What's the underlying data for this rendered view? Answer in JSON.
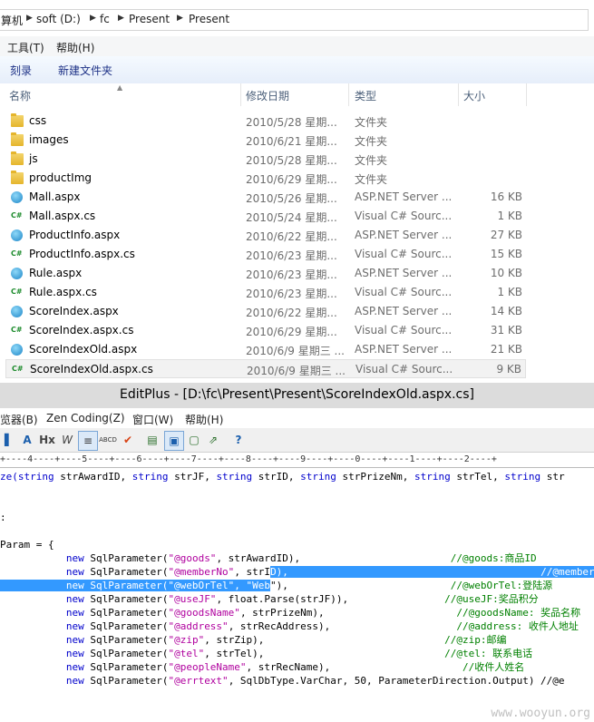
{
  "explorer": {
    "breadcrumb": [
      "算机",
      "soft (D:)",
      "fc",
      "Present",
      "Present"
    ],
    "menu": [
      "工具(T)",
      "帮助(H)"
    ],
    "commands": [
      "刻录",
      "新建文件夹"
    ],
    "columns": {
      "name": "名称",
      "date": "修改日期",
      "type": "类型",
      "size": "大小"
    },
    "files": [
      {
        "name": "css",
        "date": "2010/5/28 星期...",
        "type": "文件夹",
        "size": "",
        "icon": "folder"
      },
      {
        "name": "images",
        "date": "2010/6/21 星期...",
        "type": "文件夹",
        "size": "",
        "icon": "folder"
      },
      {
        "name": "js",
        "date": "2010/5/28 星期...",
        "type": "文件夹",
        "size": "",
        "icon": "folder"
      },
      {
        "name": "productImg",
        "date": "2010/6/29 星期...",
        "type": "文件夹",
        "size": "",
        "icon": "folder"
      },
      {
        "name": "Mall.aspx",
        "date": "2010/5/26 星期...",
        "type": "ASP.NET Server ...",
        "size": "16 KB",
        "icon": "aspx"
      },
      {
        "name": "Mall.aspx.cs",
        "date": "2010/5/24 星期...",
        "type": "Visual C# Sourc...",
        "size": "1 KB",
        "icon": "cs"
      },
      {
        "name": "ProductInfo.aspx",
        "date": "2010/6/22 星期...",
        "type": "ASP.NET Server ...",
        "size": "27 KB",
        "icon": "aspx"
      },
      {
        "name": "ProductInfo.aspx.cs",
        "date": "2010/6/23 星期...",
        "type": "Visual C# Sourc...",
        "size": "15 KB",
        "icon": "cs"
      },
      {
        "name": "Rule.aspx",
        "date": "2010/6/23 星期...",
        "type": "ASP.NET Server ...",
        "size": "10 KB",
        "icon": "aspx"
      },
      {
        "name": "Rule.aspx.cs",
        "date": "2010/6/23 星期...",
        "type": "Visual C# Sourc...",
        "size": "1 KB",
        "icon": "cs"
      },
      {
        "name": "ScoreIndex.aspx",
        "date": "2010/6/22 星期...",
        "type": "ASP.NET Server ...",
        "size": "14 KB",
        "icon": "aspx"
      },
      {
        "name": "ScoreIndex.aspx.cs",
        "date": "2010/6/29 星期...",
        "type": "Visual C# Sourc...",
        "size": "31 KB",
        "icon": "cs"
      },
      {
        "name": "ScoreIndexOld.aspx",
        "date": "2010/6/9 星期三 ...",
        "type": "ASP.NET Server ...",
        "size": "21 KB",
        "icon": "aspx"
      },
      {
        "name": "ScoreIndexOld.aspx.cs",
        "date": "2010/6/9 星期三 ...",
        "type": "Visual C# Sourc...",
        "size": "9 KB",
        "icon": "cs",
        "selected": true
      }
    ]
  },
  "editplus": {
    "title": "EditPlus - [D:\\fc\\Present\\Present\\ScoreIndexOld.aspx.cs]",
    "menu": [
      "览器(B)",
      "Zen Coding(Z)",
      "窗口(W)",
      "帮助(H)"
    ],
    "toolbar": [
      "A",
      "Hx",
      "W",
      "≡",
      "ABCD",
      "✔",
      "▤",
      "▣",
      "▢",
      "⇗",
      "?"
    ],
    "ruler": "+----4----+----5----+----6----+----7----+----8----+----9----+----0----+----1----+----2----+",
    "watermark": "www.wooyun.org"
  },
  "code_lines": [
    [
      [
        "kw",
        "ze(string"
      ],
      [
        "",
        " strAwardID, "
      ],
      [
        "kw",
        "string"
      ],
      [
        "",
        " strJF, "
      ],
      [
        "kw",
        "string"
      ],
      [
        "",
        " strID, "
      ],
      [
        "kw",
        "string"
      ],
      [
        "",
        " strPrizeNm, "
      ],
      [
        "kw",
        "string"
      ],
      [
        "",
        " strTel, "
      ],
      [
        "kw",
        "string"
      ],
      [
        "",
        " str"
      ]
    ],
    [],
    [],
    [
      [
        "",
        ":"
      ]
    ],
    [],
    [
      [
        "",
        "Param = {"
      ]
    ],
    [
      [
        "",
        "           "
      ],
      [
        "kw",
        "new"
      ],
      [
        "",
        " SqlParameter("
      ],
      [
        "str",
        "\"@goods\""
      ],
      [
        "",
        ", strAwardID),                         "
      ],
      [
        "cmt",
        "//@goods:商品ID"
      ]
    ],
    [
      [
        "",
        "           "
      ],
      [
        "kw",
        "new"
      ],
      [
        "",
        " SqlParameter("
      ],
      [
        "str",
        "\"@memberNo\""
      ],
      [
        "",
        ", strI"
      ],
      [
        "hl",
        "D),                                          "
      ],
      [
        "hl",
        "//@memberNo:会员卡号/证"
      ]
    ],
    [
      [
        "hl",
        "           new SqlParameter(\"@webOrTel\", \"Web"
      ],
      [
        "",
        "\"),                           "
      ],
      [
        "cmt",
        "//@webOrTel:登陆源"
      ]
    ],
    [
      [
        "",
        "           "
      ],
      [
        "kw",
        "new"
      ],
      [
        "",
        " SqlParameter("
      ],
      [
        "str",
        "\"@useJF\""
      ],
      [
        "",
        ", float.Parse(strJF)),                "
      ],
      [
        "cmt",
        "//@useJF:奖品积分"
      ]
    ],
    [
      [
        "",
        "           "
      ],
      [
        "kw",
        "new"
      ],
      [
        "",
        " SqlParameter("
      ],
      [
        "str",
        "\"@goodsName\""
      ],
      [
        "",
        ", strPrizeNm),                      "
      ],
      [
        "cmt",
        "//@goodsName: 奖品名称"
      ]
    ],
    [
      [
        "",
        "           "
      ],
      [
        "kw",
        "new"
      ],
      [
        "",
        " SqlParameter("
      ],
      [
        "str",
        "\"@address\""
      ],
      [
        "",
        ", strRecAddress),                     "
      ],
      [
        "cmt",
        "//@address: 收件人地址"
      ]
    ],
    [
      [
        "",
        "           "
      ],
      [
        "kw",
        "new"
      ],
      [
        "",
        " SqlParameter("
      ],
      [
        "str",
        "\"@zip\""
      ],
      [
        "",
        ", strZip),                              "
      ],
      [
        "cmt",
        "//@zip:邮编"
      ]
    ],
    [
      [
        "",
        "           "
      ],
      [
        "kw",
        "new"
      ],
      [
        "",
        " SqlParameter("
      ],
      [
        "str",
        "\"@tel\""
      ],
      [
        "",
        ", strTel),                              "
      ],
      [
        "cmt",
        "//@tel: 联系电话"
      ]
    ],
    [
      [
        "",
        "           "
      ],
      [
        "kw",
        "new"
      ],
      [
        "",
        " SqlParameter("
      ],
      [
        "str",
        "\"@peopleName\""
      ],
      [
        "",
        ", strRecName),                      "
      ],
      [
        "cmt",
        "//收件人姓名"
      ]
    ],
    [
      [
        "",
        "           "
      ],
      [
        "kw",
        "new"
      ],
      [
        "",
        " SqlParameter("
      ],
      [
        "str",
        "\"@errtext\""
      ],
      [
        "",
        ", SqlDbType.VarChar, 50, ParameterDirection.Output) //@e"
      ]
    ]
  ]
}
